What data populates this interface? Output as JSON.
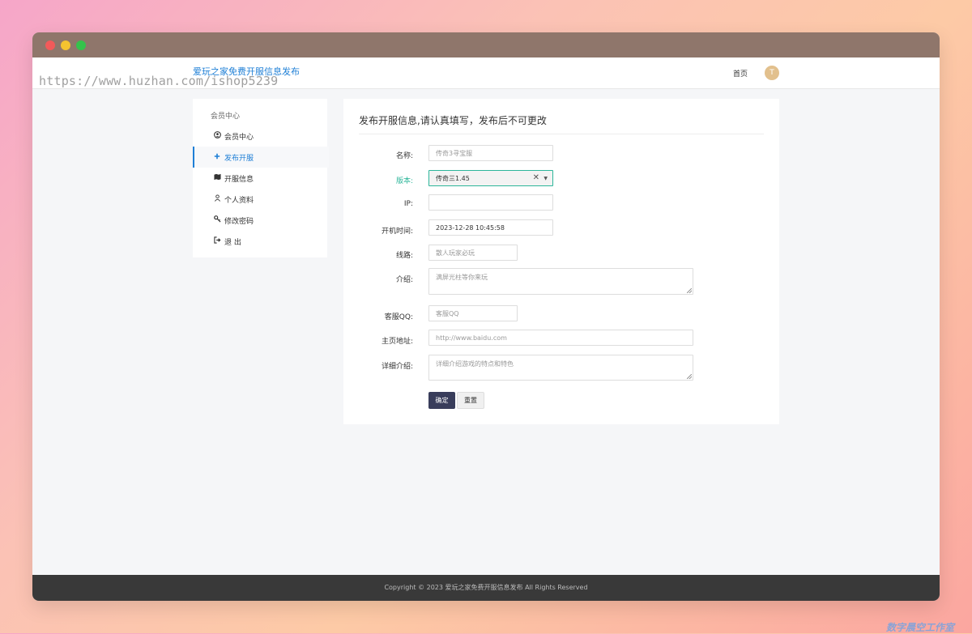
{
  "header": {
    "brand": "爱玩之家免费开服信息发布",
    "home": "首页",
    "avatar_letter": "T"
  },
  "watermark": "https://www.huzhan.com/ishop5239",
  "sidebar": {
    "title": "会员中心",
    "items": [
      {
        "label": "会员中心",
        "icon": "user-circle-icon"
      },
      {
        "label": "发布开服",
        "icon": "plus-icon"
      },
      {
        "label": "开服信息",
        "icon": "map-icon"
      },
      {
        "label": "个人资料",
        "icon": "person-icon"
      },
      {
        "label": "修改密码",
        "icon": "key-icon"
      },
      {
        "label": "退 出",
        "icon": "logout-icon"
      }
    ]
  },
  "form": {
    "title": "发布开服信息,请认真填写，发布后不可更改",
    "name": {
      "label": "名称:",
      "placeholder": "传奇3寻宝服"
    },
    "version": {
      "label": "版本:",
      "value": "传奇三1.45"
    },
    "ip": {
      "label": "IP:",
      "value": ""
    },
    "time": {
      "label": "开机时间:",
      "value": "2023-12-28 10:45:58"
    },
    "line": {
      "label": "线路:",
      "placeholder": "散人玩家必玩"
    },
    "intro": {
      "label": "介绍:",
      "placeholder": "满屏光柱等你来玩"
    },
    "qq": {
      "label": "客服QQ:",
      "placeholder": "客服QQ"
    },
    "homepage": {
      "label": "主页地址:",
      "placeholder": "http://www.baidu.com"
    },
    "detail": {
      "label": "详细介绍:",
      "placeholder": "详细介绍游戏的特点和特色"
    },
    "submit": "确定",
    "reset": "重置"
  },
  "footer": {
    "text": "Copyright © 2023 爱玩之家免费开服信息发布 All Rights Reserved"
  },
  "corner_mark": "数字晨空工作室"
}
